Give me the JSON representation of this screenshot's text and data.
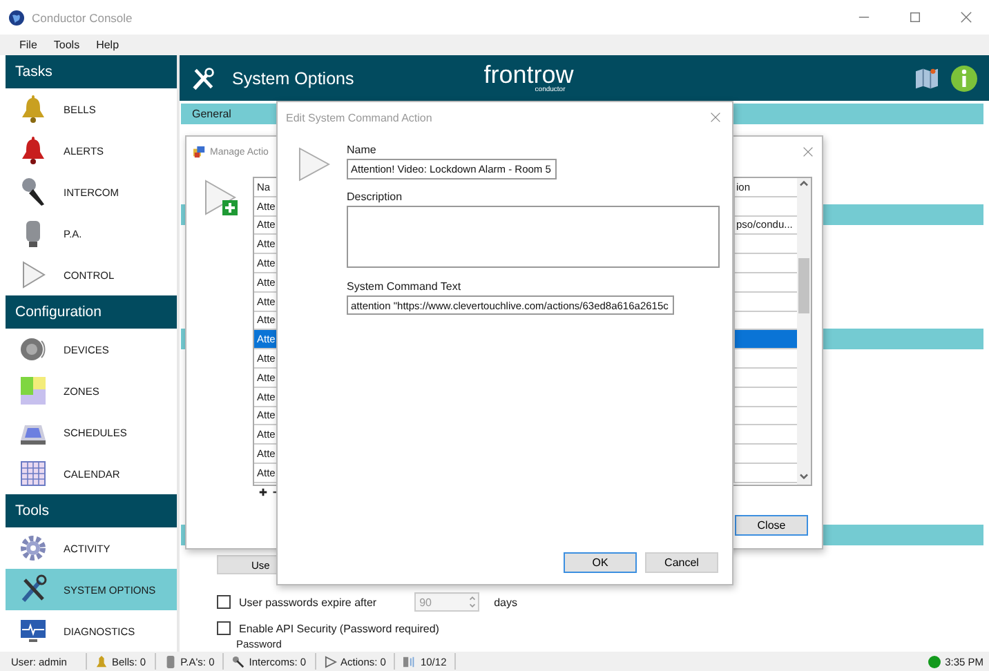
{
  "window": {
    "title": "Conductor Console"
  },
  "menu": [
    {
      "label": "File"
    },
    {
      "label": "Tools"
    },
    {
      "label": "Help"
    }
  ],
  "sidebar": [
    {
      "title": "Tasks",
      "items": [
        {
          "label": "BELLS",
          "selected": false
        },
        {
          "label": "ALERTS",
          "selected": false
        },
        {
          "label": "INTERCOM",
          "selected": false
        },
        {
          "label": "P.A.",
          "selected": false
        },
        {
          "label": "CONTROL",
          "selected": false
        }
      ]
    },
    {
      "title": "Configuration",
      "items": [
        {
          "label": "DEVICES",
          "selected": false
        },
        {
          "label": "ZONES",
          "selected": false
        },
        {
          "label": "SCHEDULES",
          "selected": false
        },
        {
          "label": "CALENDAR",
          "selected": false
        }
      ]
    },
    {
      "title": "Tools",
      "items": [
        {
          "label": "ACTIVITY",
          "selected": false
        },
        {
          "label": "SYSTEM OPTIONS",
          "selected": true
        },
        {
          "label": "DIAGNOSTICS",
          "selected": false
        }
      ]
    }
  ],
  "header": {
    "title": "System Options",
    "logo": "frontrow",
    "logo_sub": "conductor"
  },
  "general": {
    "tab": "General",
    "use_button": "Use",
    "expire": {
      "label": "User passwords expire after",
      "checked": false,
      "value": "90",
      "unit": "days"
    },
    "api": {
      "label": "Enable API Security (Password required)",
      "checked": false
    },
    "password_label": "Password"
  },
  "manage_dialog": {
    "title": "Manage Actio",
    "columns": [
      "Na",
      "ion"
    ],
    "rows": [
      {
        "name": "Atte",
        "selected": false
      },
      {
        "name": "Atte",
        "command": "pso/condu...",
        "selected": false
      },
      {
        "name": "Atte",
        "selected": false
      },
      {
        "name": "Atte",
        "selected": false
      },
      {
        "name": "Atte",
        "selected": false
      },
      {
        "name": "Atte",
        "selected": false
      },
      {
        "name": "Atte",
        "selected": false
      },
      {
        "name": "Atte",
        "selected": true
      },
      {
        "name": "Atte",
        "selected": false
      },
      {
        "name": "Atte",
        "selected": false
      },
      {
        "name": "Atte",
        "selected": false
      },
      {
        "name": "Atte",
        "selected": false
      },
      {
        "name": "Atte",
        "selected": false
      },
      {
        "name": "Atte",
        "selected": false
      },
      {
        "name": "Atte",
        "selected": false
      }
    ],
    "close": "Close"
  },
  "edit_dialog": {
    "title": "Edit System Command Action",
    "name_label": "Name",
    "name_value": "Attention! Video: Lockdown Alarm - Room 5",
    "description_label": "Description",
    "command_label": "System Command Text",
    "command_value": "attention \"https://www.clevertouchlive.com/actions/63ed8a616a2615c",
    "ok": "OK",
    "cancel": "Cancel"
  },
  "status_bar": {
    "user": "User: admin",
    "bells": "Bells: 0",
    "pas": "P.A's: 0",
    "intercoms": "Intercoms: 0",
    "actions": "Actions: 0",
    "count": "10/12",
    "time": "3:35 PM"
  }
}
